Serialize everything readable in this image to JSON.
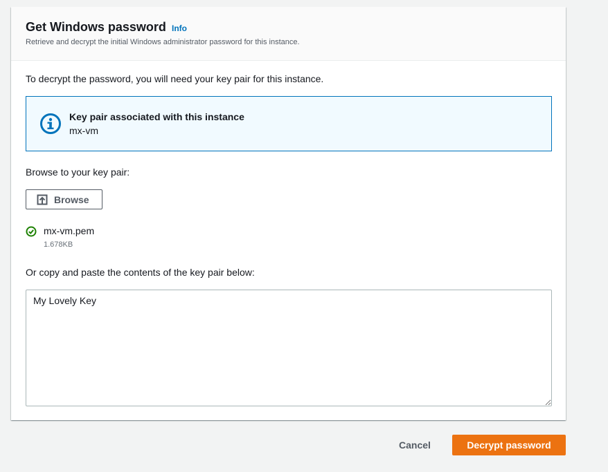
{
  "header": {
    "title": "Get Windows password",
    "info_link": "Info",
    "description": "Retrieve and decrypt the initial Windows administrator password for this instance."
  },
  "intro": "To decrypt the password, you will need your key pair for this instance.",
  "alert": {
    "icon": "info-circle-icon",
    "title": "Key pair associated with this instance",
    "value": "mx-vm"
  },
  "browse": {
    "label": "Browse to your key pair:",
    "button_label": "Browse",
    "button_icon": "upload-icon"
  },
  "file": {
    "status_icon": "check-circle-icon",
    "name": "mx-vm.pem",
    "size": "1.678KB"
  },
  "paste": {
    "label": "Or copy and paste the contents of the key pair below:",
    "value": "My Lovely Key"
  },
  "footer": {
    "cancel_label": "Cancel",
    "decrypt_label": "Decrypt password"
  },
  "colors": {
    "accent": "#0073bb",
    "primary_button": "#ec7211",
    "success": "#1d8102",
    "page_background": "#f2f3f3"
  }
}
